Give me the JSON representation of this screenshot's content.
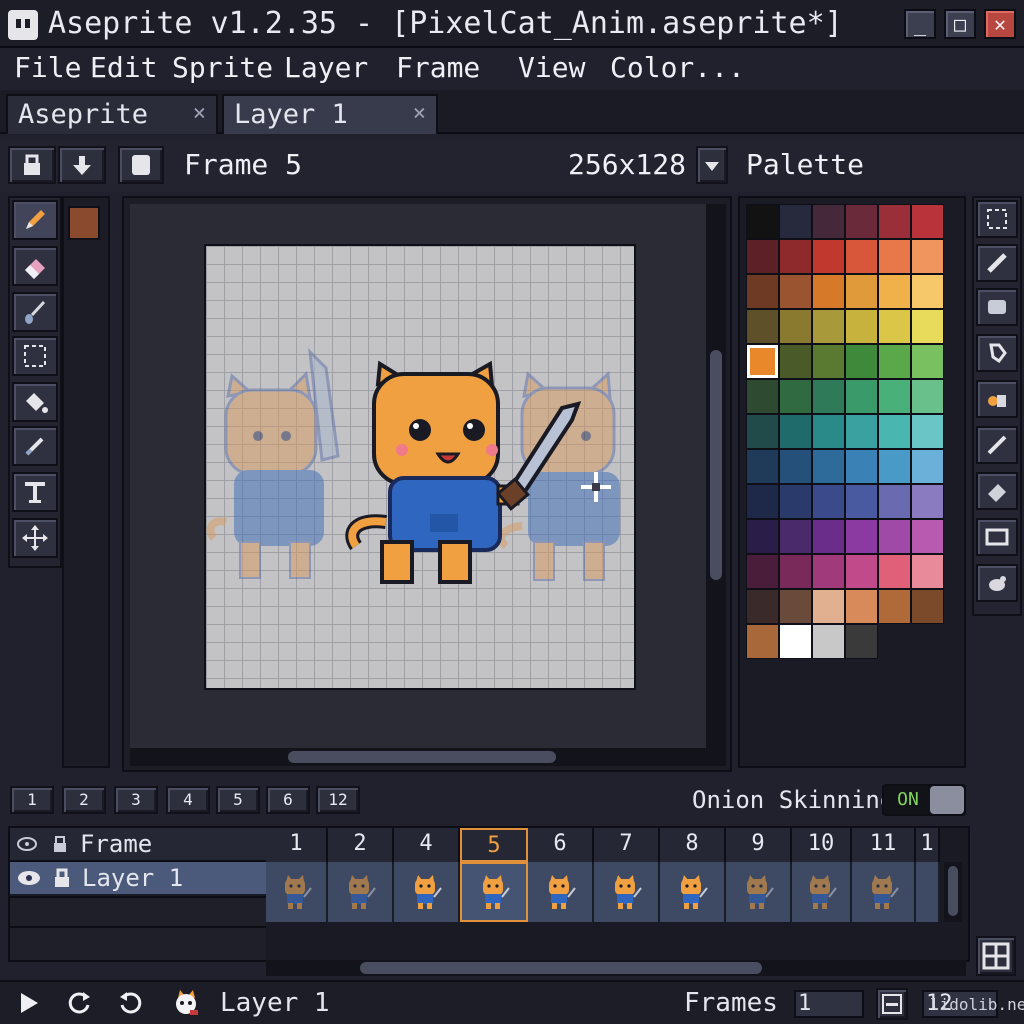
{
  "window": {
    "title": "Aseprite v1.2.35 - [PixelCat_Anim.aseprite*]",
    "minimize": "_",
    "maximize": "□",
    "close": "✕"
  },
  "menu": [
    "File",
    "Edit",
    "Sprite",
    "Layer",
    "Frame",
    "View",
    "Color..."
  ],
  "tabs": [
    {
      "label": "Aseprite",
      "close": "×"
    },
    {
      "label": "Layer 1",
      "close": "×"
    }
  ],
  "toolbar": {
    "frame_label": "Frame 5",
    "size_label": "256x128",
    "palette_label": "Palette"
  },
  "colors": {
    "foreground": "#8a4a2e",
    "accent_orange": "#e0913a",
    "selected_layer": "#4b5a7a"
  },
  "palette": [
    "#121212",
    "#262a3c",
    "#45283a",
    "#6a2a3a",
    "#9a2f3a",
    "#b8343a",
    "#5c2026",
    "#8e2a2c",
    "#c0382e",
    "#d8563a",
    "#e8774a",
    "#f0955e",
    "#6e3a24",
    "#9a5430",
    "#d67a2a",
    "#e09a3a",
    "#f0b04a",
    "#f6c86a",
    "#5e5028",
    "#8a7a30",
    "#a89a3a",
    "#c8b23e",
    "#dcc648",
    "#e8da5a",
    "#e8882a",
    "#4a5a28",
    "#5a7a32",
    "#3f8a3a",
    "#5aa84a",
    "#78c060",
    "#2e4a30",
    "#2f6a40",
    "#2f7a58",
    "#3a9a6a",
    "#4ab07a",
    "#6ac08a",
    "#214a4a",
    "#1f6a6a",
    "#2a8a8a",
    "#3aa0a0",
    "#4ab6b0",
    "#6ac6c6",
    "#203a5a",
    "#25507a",
    "#2e6a9a",
    "#3a82b6",
    "#4a9ac8",
    "#6ab0d8",
    "#1e2848",
    "#2a3a6a",
    "#3a4a8a",
    "#4a5aa0",
    "#6a6ab0",
    "#8a7ac0",
    "#2a1e48",
    "#4a2a6a",
    "#6a2e8a",
    "#8a3aa0",
    "#a04aa8",
    "#b85ab0",
    "#4a1e3a",
    "#7a2a5a",
    "#a03a7a",
    "#c04a8a",
    "#e0607a",
    "#e88a9a",
    "#3a2a2a",
    "#6a4a3a",
    "#e0b090",
    "#d88a5a",
    "#b06a3a",
    "#7a4a2a",
    "#a8683a",
    "#ffffff",
    "#c8c8c8",
    "#3a3a3a"
  ],
  "palette_selected_index": 24,
  "timeline": {
    "frame_buttons": [
      "1",
      "2",
      "3",
      "4",
      "5",
      "6",
      "12"
    ],
    "onion_label": "Onion Skinning",
    "onion_state": "ON",
    "frame_header": "Frame",
    "layer_name": "Layer 1",
    "frames": [
      "1",
      "2",
      "4",
      "5",
      "6",
      "7",
      "8",
      "9",
      "10",
      "11",
      "1"
    ],
    "active_frame_index": 3
  },
  "status": {
    "layer_label": "Layer 1",
    "frames_label": "Frames",
    "frames_value": "1",
    "frames_total": "12",
    "watermark": "lidolib.net"
  }
}
